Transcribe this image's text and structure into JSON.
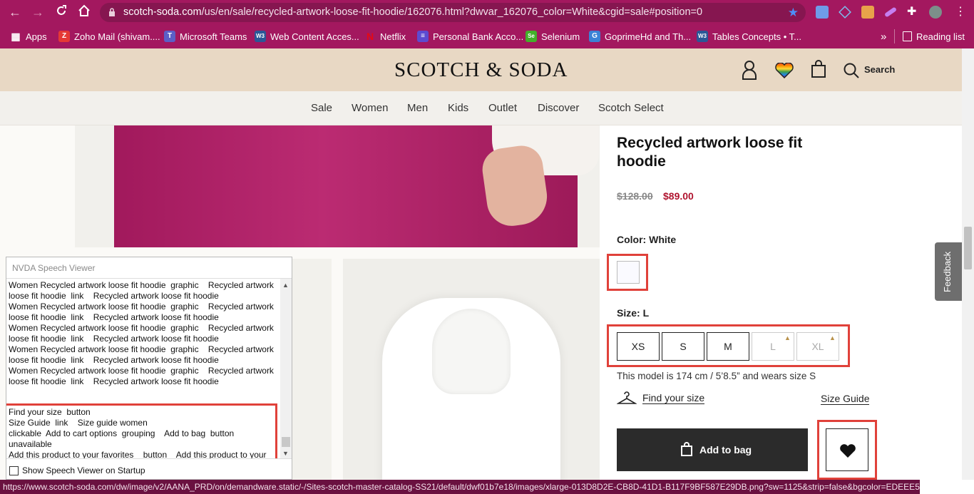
{
  "browser": {
    "url_host": "scotch-soda.com",
    "url_path": "/us/en/sale/recycled-artwork-loose-fit-hoodie/162076.html?dwvar_162076_color=White&cgid=sale#position=0",
    "status_url": "https://www.scotch-soda.com/dw/image/v2/AANA_PRD/on/demandware.static/-/Sites-scotch-master-catalog-SS21/default/dwf01b7e18/images/xlarge-013D8D2E-CB8D-41D1-B117F9BF587E29DB.png?sw=1125&strip=false&bgcolor=EDEEE5"
  },
  "bookmarks": {
    "items": [
      {
        "label": "Apps",
        "color": "#e9e9e9",
        "glyph": "▦"
      },
      {
        "label": "Zoho Mail (shivam....",
        "color": "#e53935",
        "glyph": "Z"
      },
      {
        "label": "Microsoft Teams",
        "color": "#5b5fc7",
        "glyph": "T"
      },
      {
        "label": "Web Content Acces...",
        "color": "#2b5797",
        "glyph": "W3"
      },
      {
        "label": "Netflix",
        "color": "#b00710",
        "glyph": "N"
      },
      {
        "label": "Personal Bank Acco...",
        "color": "#5c4bd1",
        "glyph": "≡"
      },
      {
        "label": "Selenium",
        "color": "#43b02a",
        "glyph": "Se"
      },
      {
        "label": "GoprimeHd and Th...",
        "color": "#3b82d6",
        "glyph": "G"
      },
      {
        "label": "Tables Concepts • T...",
        "color": "#2b5797",
        "glyph": "W3"
      }
    ],
    "more": "»",
    "reading_list": "Reading list"
  },
  "site": {
    "logo": "SCOTCH & SODA",
    "search_label": "Search",
    "nav": [
      "Sale",
      "Women",
      "Men",
      "Kids",
      "Outlet",
      "Discover",
      "Scotch Select"
    ]
  },
  "product": {
    "title": "Recycled artwork loose fit hoodie",
    "old_price": "$128.00",
    "new_price": "$89.00",
    "color_label": "Color: White",
    "size_label": "Size: L",
    "sizes": [
      {
        "label": "XS",
        "available": true
      },
      {
        "label": "S",
        "available": true
      },
      {
        "label": "M",
        "available": true
      },
      {
        "label": "L",
        "available": false
      },
      {
        "label": "XL",
        "available": false
      }
    ],
    "model_info": "This model is 174 cm / 5’8.5” and wears size S",
    "find_size": "Find your size",
    "size_guide": "Size Guide",
    "add_to_bag": "Add to bag"
  },
  "feedback": "Feedback",
  "nvda": {
    "title": "NVDA Speech Viewer",
    "log": "Women Recycled artwork loose fit hoodie  graphic    Recycled artwork loose fit hoodie  link    Recycled artwork loose fit hoodie\nWomen Recycled artwork loose fit hoodie  graphic    Recycled artwork loose fit hoodie  link    Recycled artwork loose fit hoodie\nWomen Recycled artwork loose fit hoodie  graphic    Recycled artwork loose fit hoodie  link    Recycled artwork loose fit hoodie\nWomen Recycled artwork loose fit hoodie  graphic    Recycled artwork loose fit hoodie  link    Recycled artwork loose fit hoodie\nWomen Recycled artwork loose fit hoodie  graphic    Recycled artwork loose fit hoodie  link    Recycled artwork loose fit hoodie",
    "highlight": "Find your size  button\nSize Guide  link    Size guide women\nclickable  Add to cart options  grouping    Add to bag  button\nunavailable\nAdd this product to your favorites    button    Add this product to your favorites",
    "startup_label": "Show Speech Viewer on Startup"
  }
}
